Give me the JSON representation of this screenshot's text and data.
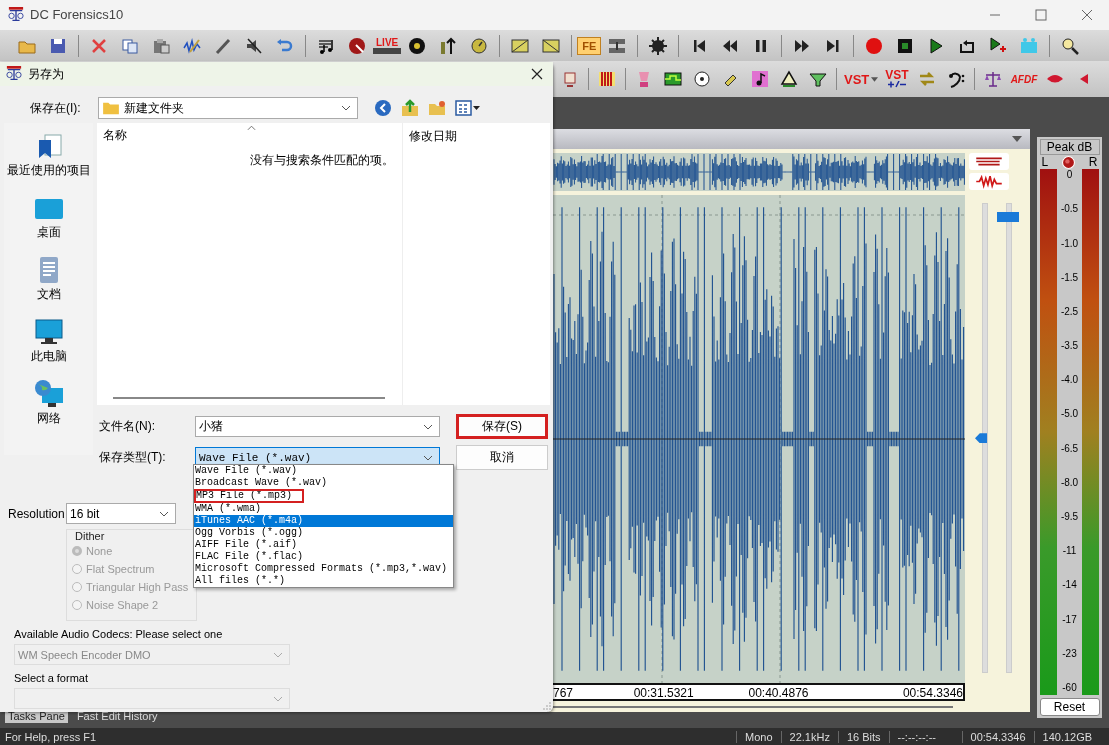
{
  "window": {
    "title": "DC Forensics10"
  },
  "toolbar_texts": {
    "live": "LIVE",
    "fe": "FE",
    "fe_on": true,
    "vst": "VST",
    "vst_adjust": "VST",
    "afdf": "AFDF"
  },
  "save_dialog": {
    "title": "另存为",
    "save_in_label": "保存在(I):",
    "save_in_value": "新建文件夹",
    "places": [
      {
        "kind": "recent",
        "label": "最近使用的项目"
      },
      {
        "kind": "desktop",
        "label": "桌面"
      },
      {
        "kind": "documents",
        "label": "文档"
      },
      {
        "kind": "pc",
        "label": "此电脑"
      },
      {
        "kind": "network",
        "label": "网络"
      }
    ],
    "columns": [
      "名称",
      "修改日期"
    ],
    "empty_message": "没有与搜索条件匹配的项。",
    "filename_label": "文件名(N):",
    "filename_value": "小猪",
    "type_label": "保存类型(T):",
    "type_value": "Wave File (*.wav)",
    "type_options": [
      {
        "label": "Wave File (*.wav)",
        "selected": false,
        "highlighted": false
      },
      {
        "label": "Broadcast Wave (*.wav)",
        "selected": false,
        "highlighted": false
      },
      {
        "label": "MP3 File (*.mp3)",
        "selected": false,
        "highlighted": true
      },
      {
        "label": "WMA (*.wma)",
        "selected": false,
        "highlighted": false
      },
      {
        "label": "iTunes AAC (*.m4a)",
        "selected": true,
        "highlighted": false
      },
      {
        "label": "Ogg Vorbis (*.ogg)",
        "selected": false,
        "highlighted": false
      },
      {
        "label": "AIFF File (*.aif)",
        "selected": false,
        "highlighted": false
      },
      {
        "label": "FLAC File (*.flac)",
        "selected": false,
        "highlighted": false
      },
      {
        "label": "Microsoft Compressed Formats (*.mp3,*.wav)",
        "selected": false,
        "highlighted": false
      },
      {
        "label": "All files (*.*)",
        "selected": false,
        "highlighted": false
      }
    ],
    "buttons": [
      {
        "label": "保存(S)",
        "highlighted": true
      },
      {
        "label": "取消",
        "highlighted": false
      }
    ],
    "resolution": {
      "label": "Resolution",
      "value": "16 bit"
    },
    "dither": {
      "label": "Dither",
      "disabled": true,
      "options": [
        {
          "label": "None",
          "checked": true
        },
        {
          "label": "Flat Spectrum",
          "checked": false
        },
        {
          "label": "Triangular High Pass",
          "checked": false
        },
        {
          "label": "Noise Shape 2",
          "checked": false
        }
      ]
    },
    "codecs": {
      "label": "Available Audio Codecs: Please select one",
      "value": "WM Speech Encoder DMO",
      "disabled": true
    },
    "format": {
      "label": "Select a format",
      "disabled": true
    }
  },
  "waveform": {
    "ruler": [
      "767",
      "00:31.5321",
      "00:40.4876",
      "00:54.3346"
    ],
    "zoom_sliders": [
      {
        "level": 0.5
      },
      {
        "level": 0.98
      }
    ]
  },
  "meter": {
    "title": "Peak dB",
    "left": "L",
    "right": "R",
    "scale": [
      "0",
      "-0.5",
      "-1.0",
      "-1.5",
      "-2.5",
      "-3.5",
      "-4.0",
      "-5.0",
      "-6.5",
      "-8.0",
      "-9.5",
      "-11",
      "-14",
      "-17",
      "-23",
      "-60"
    ],
    "reset": "Reset"
  },
  "panel_tabs": [
    {
      "label": "Tasks Pane",
      "selected": true
    },
    {
      "label": "Fast Edit History",
      "selected": false
    }
  ],
  "status_bar": {
    "help": "For Help, press F1",
    "fields": [
      "Mono",
      "22.1kHz",
      "16 Bits",
      "--:--:--:--",
      "00:54.3346",
      "140.12GB"
    ]
  }
}
